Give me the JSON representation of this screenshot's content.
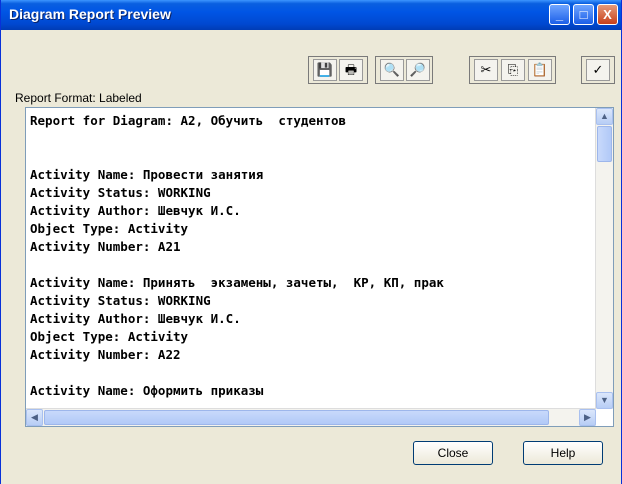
{
  "window": {
    "title": "Diagram Report Preview"
  },
  "titlebar_buttons": {
    "minimize": "_",
    "maximize": "□",
    "close": "X"
  },
  "toolbar": [
    {
      "name": "save-icon",
      "glyph": "💾"
    },
    {
      "name": "print-icon",
      "glyph": "🖶"
    },
    {
      "name": "find-icon",
      "glyph": "🔍"
    },
    {
      "name": "find-replace-icon",
      "glyph": "🔎"
    },
    {
      "name": "cut-icon",
      "glyph": "✂"
    },
    {
      "name": "copy-icon",
      "glyph": "⎘"
    },
    {
      "name": "paste-icon",
      "glyph": "📋"
    },
    {
      "name": "spellcheck-icon",
      "glyph": "✓"
    }
  ],
  "report_format_label": "Report Format: Labeled",
  "report_lines": [
    "Report for Diagram: A2, Обучить  студентов",
    "",
    "",
    "Activity Name: Провести занятия",
    "Activity Status: WORKING",
    "Activity Author: Шевчук И.С.",
    "Object Type: Activity",
    "Activity Number: A21",
    "",
    "Activity Name: Принять  экзамены, зачеты,  КР, КП, прак",
    "Activity Status: WORKING",
    "Activity Author: Шевчук И.С.",
    "Object Type: Activity",
    "Activity Number: A22",
    "",
    "Activity Name: Оформить приказы"
  ],
  "buttons": {
    "close": "Close",
    "help": "Help"
  }
}
